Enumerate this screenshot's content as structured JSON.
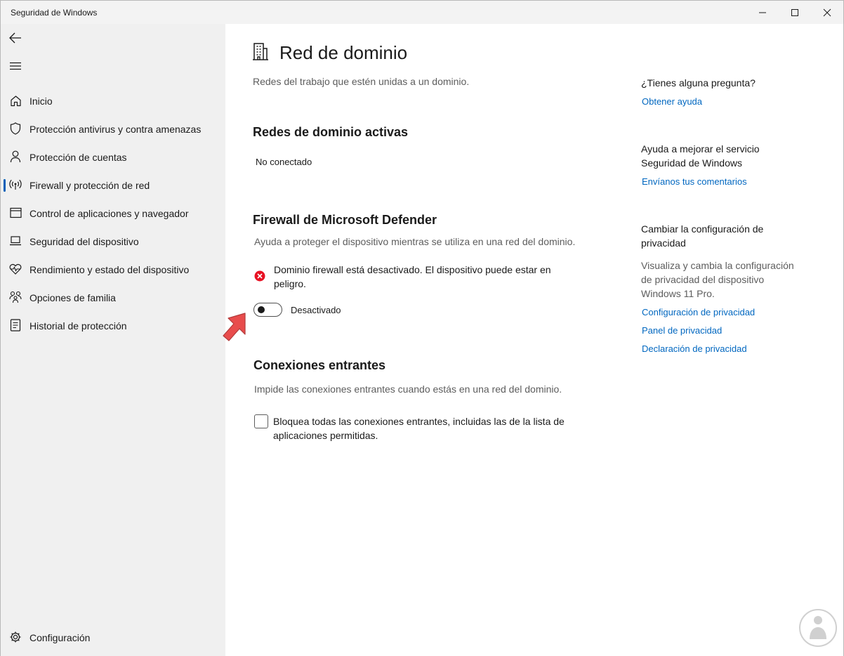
{
  "window": {
    "title": "Seguridad de Windows"
  },
  "sidebar": {
    "items": [
      {
        "label": "Inicio",
        "icon": "home-icon"
      },
      {
        "label": "Protección antivirus y contra amenazas",
        "icon": "shield-icon"
      },
      {
        "label": "Protección de cuentas",
        "icon": "person-icon"
      },
      {
        "label": "Firewall y protección de red",
        "icon": "antenna-icon",
        "active": true
      },
      {
        "label": "Control de aplicaciones y navegador",
        "icon": "app-browser-icon"
      },
      {
        "label": "Seguridad del dispositivo",
        "icon": "laptop-icon"
      },
      {
        "label": "Rendimiento y estado del dispositivo",
        "icon": "heart-pulse-icon"
      },
      {
        "label": "Opciones de familia",
        "icon": "family-icon"
      },
      {
        "label": "Historial de protección",
        "icon": "history-icon"
      }
    ],
    "settings_label": "Configuración"
  },
  "main": {
    "title": "Red de dominio",
    "subtitle": "Redes del trabajo que estén unidas a un dominio.",
    "active_networks": {
      "heading": "Redes de dominio activas",
      "value": "No conectado"
    },
    "firewall": {
      "heading": "Firewall de Microsoft Defender",
      "description": "Ayuda a proteger el dispositivo mientras se utiliza en una red del dominio.",
      "warning_line1": "Dominio firewall está desactivado. El dispositivo puede estar en",
      "warning_line2": "peligro.",
      "toggle_label": "Desactivado",
      "toggle_on": false
    },
    "incoming": {
      "heading": "Conexiones entrantes",
      "description": "Impide las conexiones entrantes cuando estás en una red del dominio.",
      "checkbox_line1": "Bloquea todas las conexiones entrantes, incluidas las de la lista de",
      "checkbox_line2": "aplicaciones permitidas.",
      "checked": false
    }
  },
  "aside": {
    "question": "¿Tienes alguna pregunta?",
    "help_link": "Obtener ayuda",
    "improve_line1": "Ayuda a mejorar el servicio",
    "improve_line2": "Seguridad de Windows",
    "feedback_link": "Envíanos tus comentarios",
    "privacy_heading_line1": "Cambiar la configuración de",
    "privacy_heading_line2": "privacidad",
    "privacy_desc_line1": "Visualiza y cambia la configuración",
    "privacy_desc_line2": "de privacidad del dispositivo",
    "privacy_desc_line3": "Windows 11 Pro.",
    "privacy_links": [
      "Configuración de privacidad",
      "Panel de privacidad",
      "Declaración de privacidad"
    ]
  },
  "colors": {
    "accent": "#005fb8",
    "link": "#0067c0",
    "error": "#e81123",
    "arrow": "#e84c4c"
  }
}
